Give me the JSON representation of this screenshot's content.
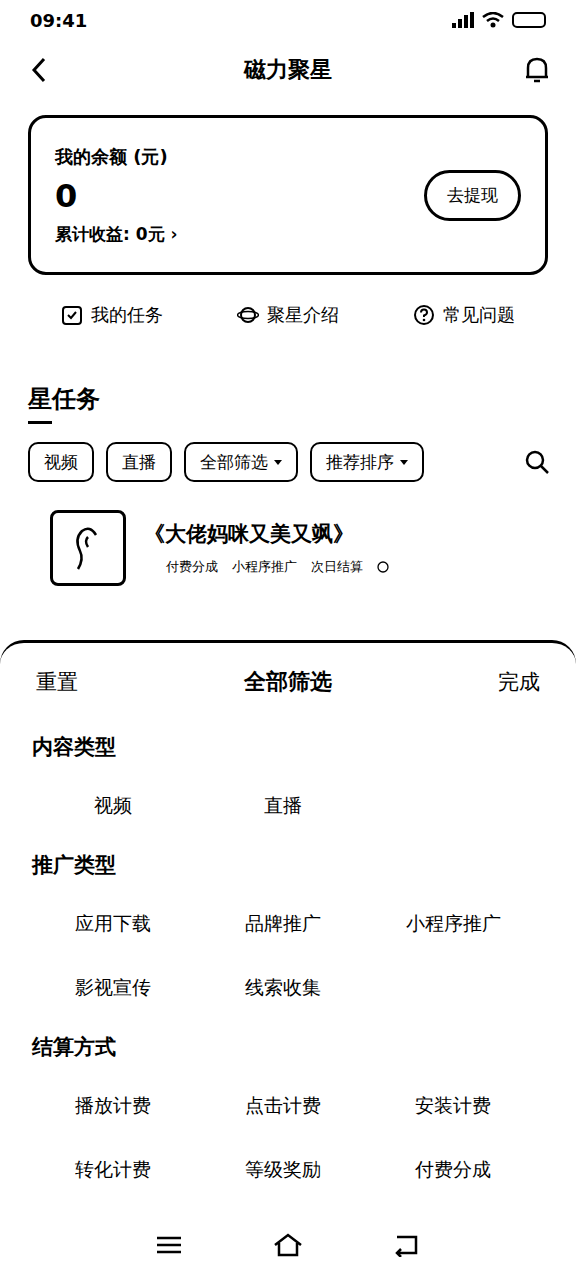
{
  "status_bar": {
    "time": "09:41"
  },
  "header": {
    "title": "磁力聚星"
  },
  "balance": {
    "label": "我的余额 (元)",
    "amount": "0",
    "total": "累计收益: 0元",
    "chevron": "›",
    "button": "去提现"
  },
  "shortcuts": [
    {
      "label": "我的任务"
    },
    {
      "label": "聚星介绍"
    },
    {
      "label": "常见问题"
    }
  ],
  "section_title": "星任务",
  "filters": [
    {
      "label": "视频",
      "dropdown": false
    },
    {
      "label": "直播",
      "dropdown": false
    },
    {
      "label": "全部筛选",
      "dropdown": true
    },
    {
      "label": "推荐排序",
      "dropdown": true
    }
  ],
  "tasks": [
    {
      "title": "《大佬妈咪又美又飒》",
      "tags": [
        "付费分成",
        "小程序推广",
        "次日结算"
      ]
    }
  ],
  "sheet": {
    "reset": "重置",
    "title": "全部筛选",
    "done": "完成",
    "groups": [
      {
        "title": "内容类型",
        "options": [
          {
            "label": "视频",
            "selected": false
          },
          {
            "label": "直播",
            "selected": false
          }
        ]
      },
      {
        "title": "推广类型",
        "options": [
          {
            "label": "应用下载",
            "selected": false
          },
          {
            "label": "品牌推广",
            "selected": false
          },
          {
            "label": "小程序推广",
            "selected": false
          },
          {
            "label": "影视宣传",
            "selected": false
          },
          {
            "label": "线索收集",
            "selected": false
          }
        ]
      },
      {
        "title": "结算方式",
        "options": [
          {
            "label": "播放计费",
            "selected": false
          },
          {
            "label": "点击计费",
            "selected": false
          },
          {
            "label": "安装计费",
            "selected": false
          },
          {
            "label": "转化计费",
            "selected": false
          },
          {
            "label": "等级奖励",
            "selected": false
          },
          {
            "label": "付费分成",
            "selected": false
          }
        ]
      }
    ]
  }
}
